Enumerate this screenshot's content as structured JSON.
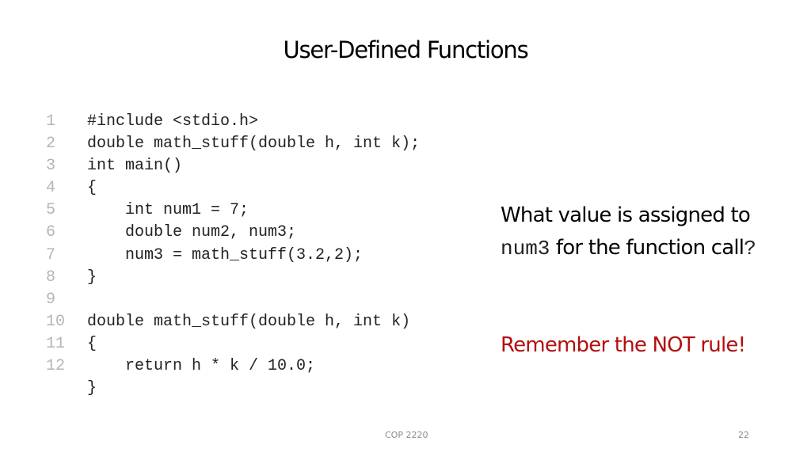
{
  "slide": {
    "title": "User-Defined Functions",
    "code_lines": [
      {
        "number": "1",
        "text": "#include <stdio.h>"
      },
      {
        "number": "2",
        "text": "double math_stuff(double h, int k);"
      },
      {
        "number": "3",
        "text": "int main()"
      },
      {
        "number": "4",
        "text": "{"
      },
      {
        "number": "5",
        "text": "    int num1 = 7;"
      },
      {
        "number": "6",
        "text": "    double num2, num3;"
      },
      {
        "number": "7",
        "text": "    num3 = math_stuff(3.2,2);"
      },
      {
        "number": "8",
        "text": "}"
      },
      {
        "number": "9",
        "text": ""
      },
      {
        "number": "10",
        "text": "double math_stuff(double h, int k)"
      },
      {
        "number": "11",
        "text": "{"
      },
      {
        "number": "12",
        "text": "    return h * k / 10.0;"
      },
      {
        "number": "",
        "text": "}"
      }
    ],
    "question": {
      "part1": "What value is assigned to ",
      "var": "num3",
      "part2": "  for  the function call",
      "qmark": "?"
    },
    "reminder": "Remember the NOT rule!",
    "footer": {
      "course": "COP 2220",
      "page_number": "22"
    },
    "colors": {
      "reminder": "#b30f0f",
      "line_numbers": "#b5b5b5"
    }
  }
}
